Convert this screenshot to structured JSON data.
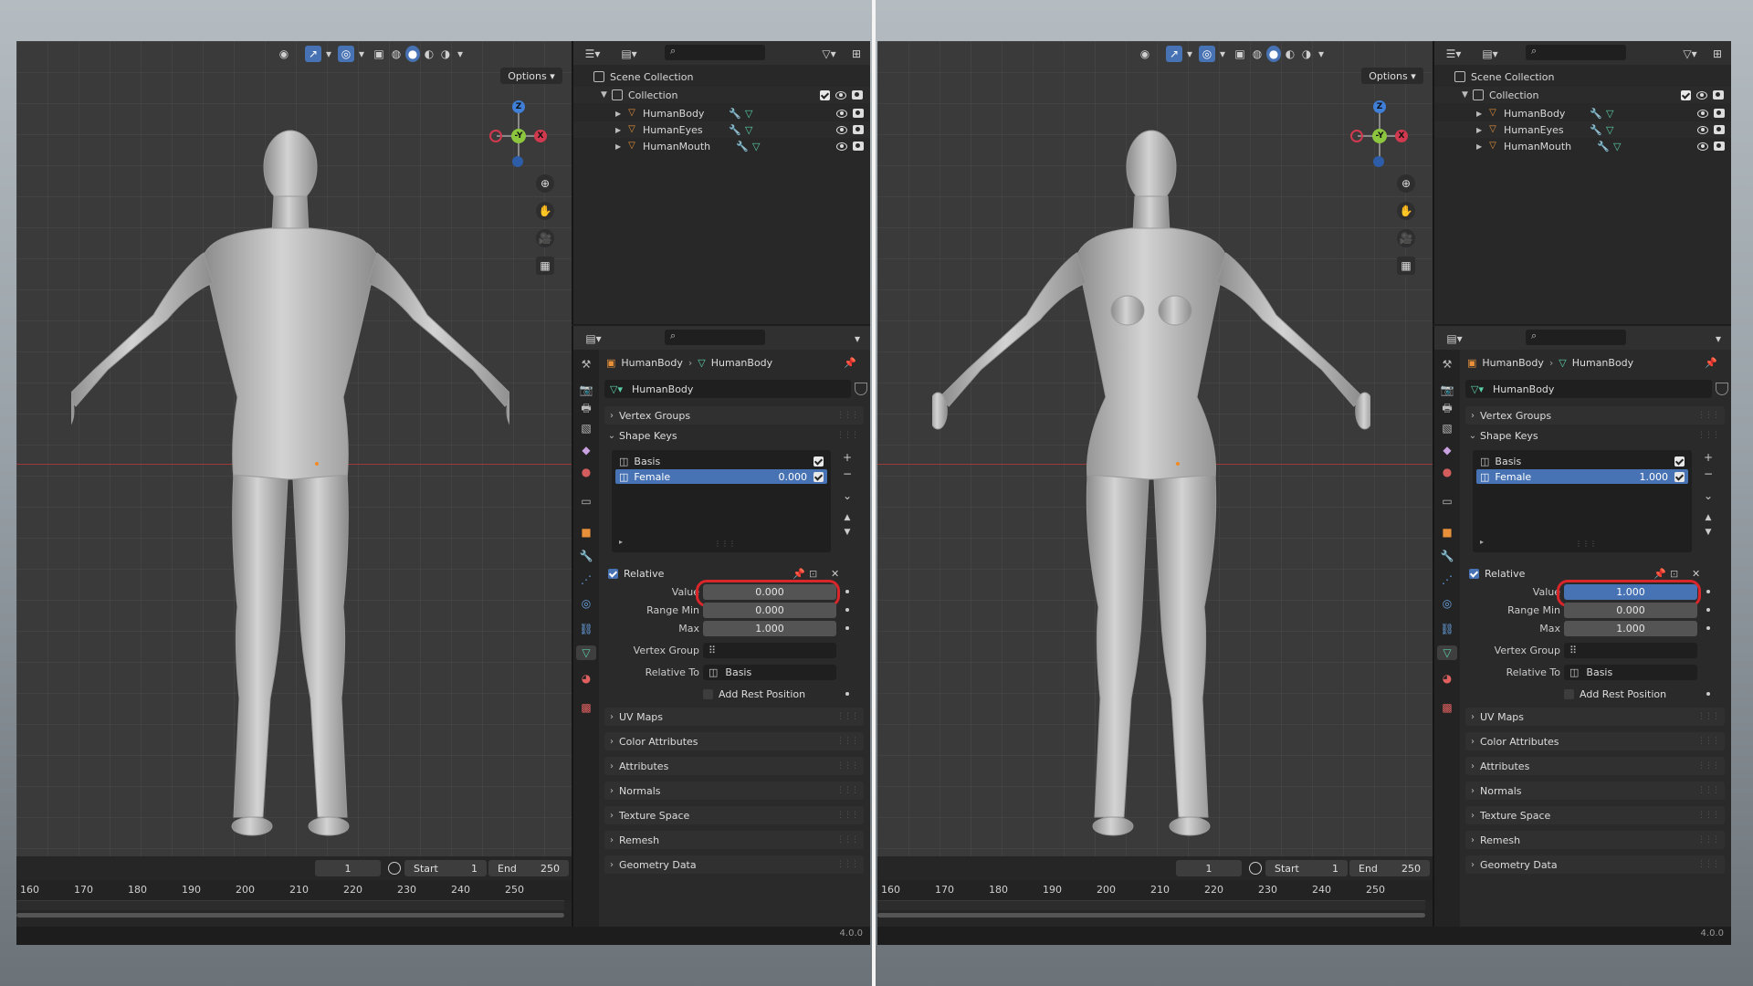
{
  "screens": [
    {
      "id": "left",
      "figure": "male",
      "shape_key_value": "0.000",
      "value_highlighted": false
    },
    {
      "id": "right",
      "figure": "female",
      "shape_key_value": "1.000",
      "value_highlighted": true
    }
  ],
  "viewport": {
    "options_label": "Options",
    "gizmo": {
      "z": "Z",
      "y": "-Y",
      "x": "X"
    }
  },
  "outliner": {
    "scene_collection": "Scene Collection",
    "collection": "Collection",
    "objects": [
      "HumanBody",
      "HumanEyes",
      "HumanMouth"
    ]
  },
  "properties": {
    "breadcrumb_object": "HumanBody",
    "breadcrumb_mesh": "HumanBody",
    "mesh_name": "HumanBody",
    "panels_top": [
      "Vertex Groups",
      "Shape Keys"
    ],
    "shape_keys": [
      {
        "name": "Basis"
      },
      {
        "name": "Female"
      }
    ],
    "relative_label": "Relative",
    "value_label": "Value",
    "range_min_label": "Range Min",
    "range_min": "0.000",
    "max_label": "Max",
    "max": "1.000",
    "vertex_group_label": "Vertex Group",
    "relative_to_label": "Relative To",
    "relative_to_value": "Basis",
    "add_rest_position": "Add Rest Position",
    "panels_bottom": [
      "UV Maps",
      "Color Attributes",
      "Attributes",
      "Normals",
      "Texture Space",
      "Remesh",
      "Geometry Data"
    ]
  },
  "timeline": {
    "current_frame": "1",
    "start_label": "Start",
    "start_value": "1",
    "end_label": "End",
    "end_value": "250",
    "ticks": [
      "160",
      "170",
      "180",
      "190",
      "200",
      "210",
      "220",
      "230",
      "240",
      "250"
    ]
  },
  "version": "4.0.0",
  "colors": {
    "accent": "#4772b3",
    "highlight_circle": "#d8262a",
    "object_icon": "#e8913a",
    "modifier_icon": "#6aa6e6",
    "mesh_icon": "#5ad0a8"
  }
}
